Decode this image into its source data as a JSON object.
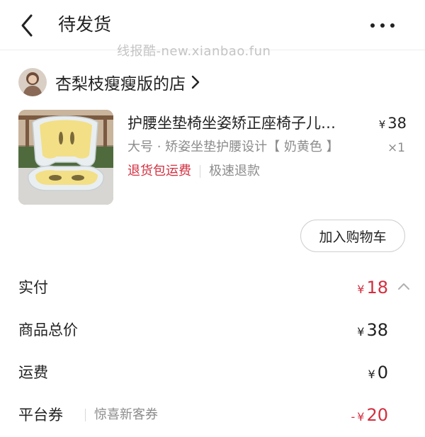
{
  "header": {
    "title": "待发货"
  },
  "watermark": "线报酷-new.xianbao.fun",
  "shop": {
    "name": "杏梨枝瘦瘦版的店"
  },
  "product": {
    "title": "护腰坐垫椅坐姿矫正座椅子儿…",
    "currency": "¥",
    "price": "38",
    "spec": "大号 · 矫姿坐垫护腰设计【 奶黄色 】",
    "quantity": "×1",
    "tag_return": "退货包运费",
    "tag_refund": "极速退款"
  },
  "actions": {
    "add_to_cart": "加入购物车"
  },
  "summary": {
    "paid_label": "实付",
    "paid_currency": "¥",
    "paid_value": "18",
    "total_label": "商品总价",
    "total_currency": "¥",
    "total_value": "38",
    "shipping_label": "运费",
    "shipping_currency": "¥",
    "shipping_value": "0",
    "coupon_label": "平台券",
    "coupon_desc": "惊喜新客券",
    "coupon_sign": "-",
    "coupon_currency": "¥",
    "coupon_value": "20"
  },
  "colors": {
    "accent_red": "#d22f3f",
    "muted_text": "#8c8c8c"
  },
  "icons": {
    "back": "back-arrow-icon",
    "more": "more-dots-icon",
    "shop_chevron": "chevron-right-icon",
    "expand": "chevron-up-icon"
  }
}
